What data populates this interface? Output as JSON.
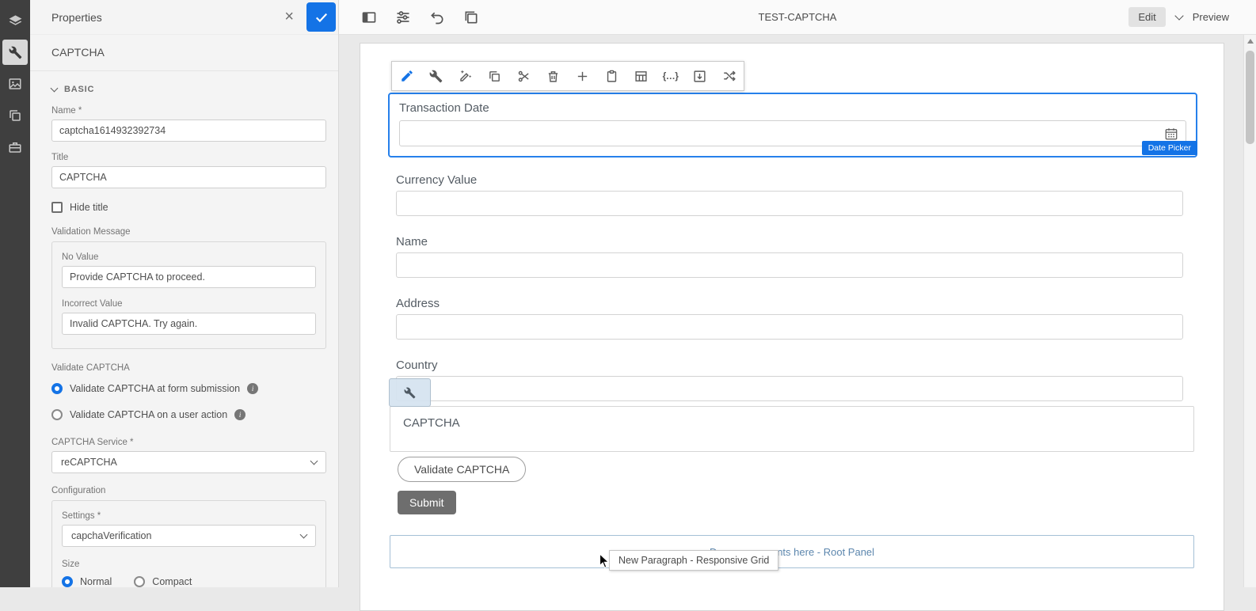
{
  "colors": {
    "accent": "#1473e6",
    "selection_border": "#2680eb",
    "rail_bg": "#3f3f3f",
    "panel_bg": "#f4f4f4",
    "canvas_bg": "#e9e9e9",
    "submit_bg": "#6e6e6e",
    "dropzone_text": "#5d87ae"
  },
  "icon_rail": {
    "items": [
      {
        "icon": "layers-icon",
        "selected": false
      },
      {
        "icon": "wrench-icon",
        "selected": true
      },
      {
        "icon": "assets-icon",
        "selected": false
      },
      {
        "icon": "components-icon",
        "selected": false
      },
      {
        "icon": "toolbox-icon",
        "selected": false
      }
    ]
  },
  "properties_panel": {
    "title": "Properties",
    "component_heading": "CAPTCHA",
    "basic_section_label": "BASIC",
    "name_field": {
      "label": "Name *",
      "value": "captcha1614932392734"
    },
    "title_field": {
      "label": "Title",
      "value": "CAPTCHA"
    },
    "hide_title": {
      "label": "Hide title",
      "checked": false
    },
    "validation_message_label": "Validation Message",
    "no_value_field": {
      "label": "No Value",
      "value": "Provide CAPTCHA to proceed."
    },
    "incorrect_value_field": {
      "label": "Incorrect Value",
      "value": "Invalid CAPTCHA. Try again."
    },
    "validate_captcha_label": "Validate CAPTCHA",
    "validate_options": [
      {
        "label": "Validate CAPTCHA at form submission",
        "selected": true
      },
      {
        "label": "Validate CAPTCHA on a user action",
        "selected": false
      }
    ],
    "captcha_service": {
      "label": "CAPTCHA Service *",
      "value": "reCAPTCHA"
    },
    "configuration_label": "Configuration",
    "settings_field": {
      "label": "Settings *",
      "value": "capchaVerification"
    },
    "size_field": {
      "label": "Size",
      "options": [
        {
          "label": "Normal",
          "selected": true
        },
        {
          "label": "Compact",
          "selected": false
        }
      ]
    }
  },
  "top_bar": {
    "icons": [
      "side-panel-toggle-icon",
      "preferences-icon",
      "undo-icon",
      "duplicate-icon"
    ],
    "title": "TEST-CAPTCHA",
    "edit_label": "Edit",
    "preview_label": "Preview"
  },
  "component_toolbar": {
    "icons": [
      "edit-icon",
      "configure-icon",
      "edit-rules-icon",
      "copy-icon",
      "cut-icon",
      "delete-icon",
      "insert-icon",
      "paste-icon",
      "group-icon",
      "expression-icon",
      "save-icon",
      "replace-icon"
    ]
  },
  "canvas": {
    "selected_field": {
      "label": "Transaction Date",
      "badge": "Date Picker"
    },
    "fields": [
      {
        "label": "Currency Value"
      },
      {
        "label": "Name"
      },
      {
        "label": "Address"
      },
      {
        "label": "Country"
      }
    ],
    "captcha_section_label": "CAPTCHA",
    "validate_button_label": "Validate CAPTCHA",
    "submit_button_label": "Submit",
    "drop_zone_text": "Drag components here - Root Panel",
    "tooltip_text": "New Paragraph - Responsive Grid"
  }
}
